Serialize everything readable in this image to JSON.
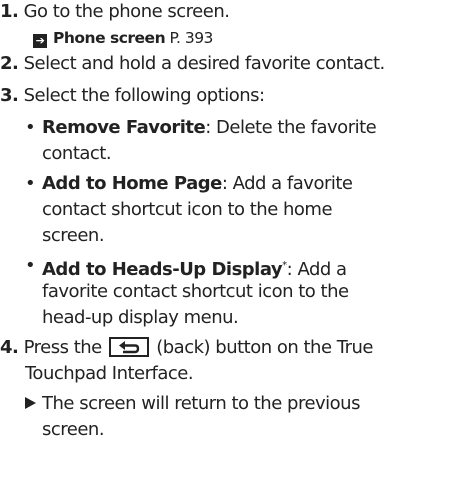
{
  "steps": [
    {
      "num": "1.",
      "text": "Go to the phone screen."
    },
    {
      "num": "2.",
      "text": "Select and hold a desired favorite contact."
    },
    {
      "num": "3.",
      "text": "Select the following options:"
    },
    {
      "num": "4.",
      "text_before": "Press the",
      "text_after": "(back) button on the True",
      "text_cont": "Touchpad Interface."
    }
  ],
  "xref": {
    "label": "Phone screen",
    "page": "P. 393"
  },
  "options": [
    {
      "bullet": "•",
      "term": "Remove Favorite",
      "desc_1": ": Delete the favorite",
      "desc_2": "contact."
    },
    {
      "bullet": "•",
      "term": "Add to Home Page",
      "desc_1": ": Add a favorite",
      "desc_2": "contact shortcut icon to the home",
      "desc_3": "screen."
    },
    {
      "bullet": "•",
      "term": "Add to Heads-Up Display",
      "asterisk": "*",
      "desc_1": ": Add a",
      "desc_2": "favorite contact shortcut icon to the",
      "desc_3": "head-up display menu."
    }
  ],
  "result": {
    "line_1": "The screen will return to the previous",
    "line_2": "screen."
  }
}
